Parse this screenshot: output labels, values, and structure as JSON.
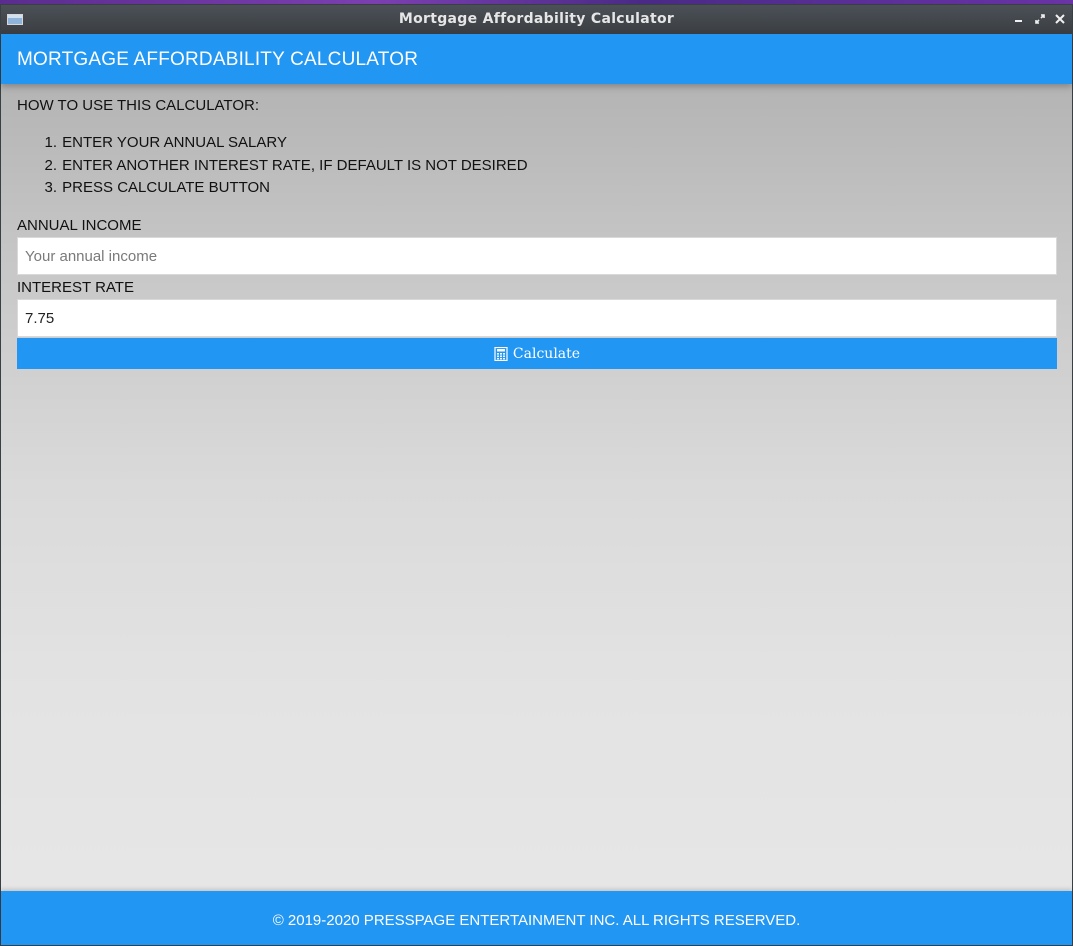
{
  "window": {
    "title": "Mortgage Affordability Calculator",
    "controls": [
      "minimize-icon",
      "maximize-icon",
      "close-icon"
    ]
  },
  "header": {
    "heading": "MORTGAGE AFFORDABILITY CALCULATOR"
  },
  "instructions": {
    "title": "HOW TO USE THIS CALCULATOR:",
    "steps": [
      {
        "num": "1.",
        "text": "ENTER YOUR ANNUAL SALARY"
      },
      {
        "num": "2.",
        "text": "ENTER ANOTHER INTEREST RATE, IF DEFAULT IS NOT DESIRED"
      },
      {
        "num": "3.",
        "text": "PRESS CALCULATE BUTTON"
      }
    ]
  },
  "form": {
    "income_label": "ANNUAL INCOME",
    "income_value": "",
    "income_placeholder": "Your annual income",
    "rate_label": "INTEREST RATE",
    "rate_value": "7.75",
    "calculate_label": "Calculate",
    "calculate_icon": "calculator-icon"
  },
  "footer": {
    "copyright": "© 2019-2020 PRESSPAGE ENTERTAINMENT INC. ALL RIGHTS RESERVED."
  },
  "colors": {
    "primary": "#2196f3",
    "titlebar": "#3a3e43",
    "background": "#e3e3e3"
  }
}
